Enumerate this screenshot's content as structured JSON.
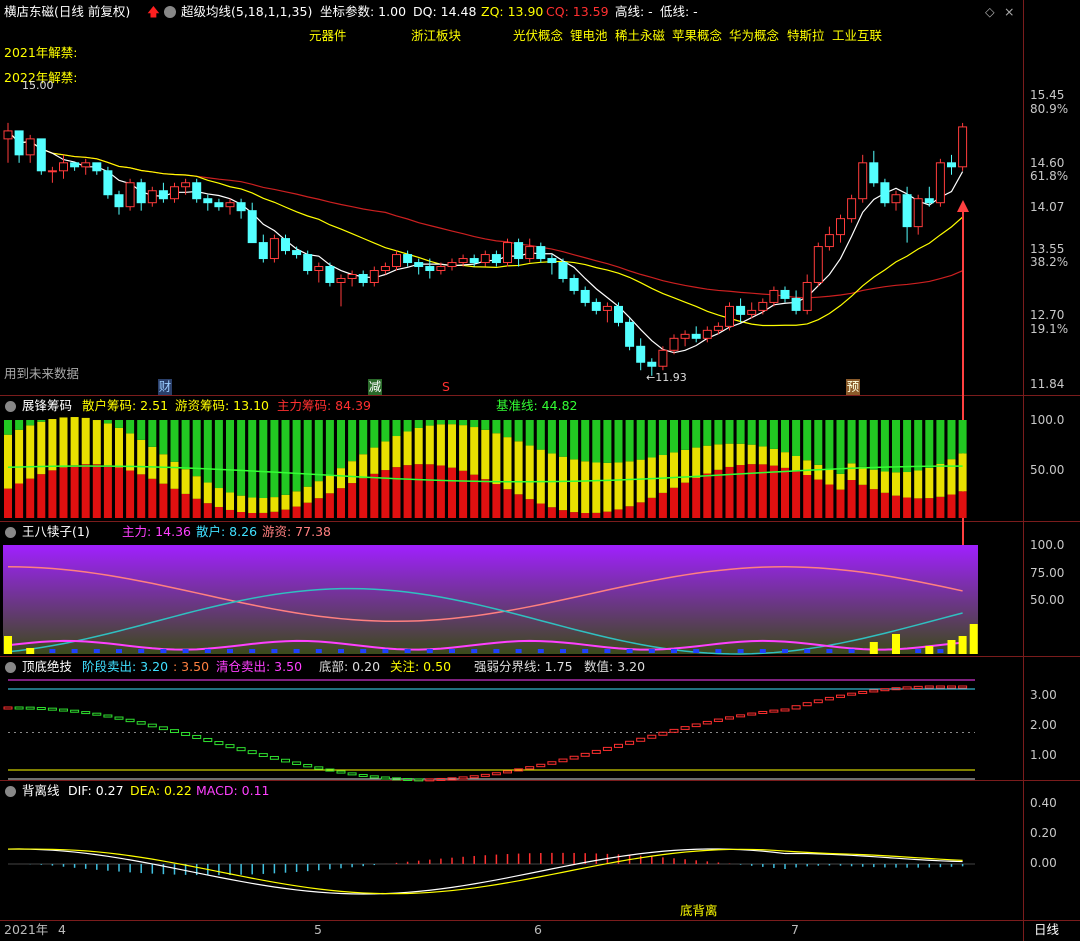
{
  "main": {
    "stock_title": "横店东磁(日线 前复权)",
    "indicator_name": "超级均线(5,18,1,1,35)",
    "params": "坐标参数: 1.00",
    "dq": "DQ: 14.48",
    "zq": "ZQ: 13.90",
    "cq": "CQ: 13.59",
    "high_line": "高线: -",
    "low_line": "低线: -",
    "tags": [
      "元器件",
      "浙江板块",
      "光伏概念",
      "锂电池",
      "稀土永磁",
      "苹果概念",
      "华为概念",
      "特斯拉",
      "工业互联"
    ],
    "unlock_2021": "2021年解禁:",
    "unlock_2022": "2022年解禁:",
    "future_data": "用到未来数据",
    "max_price_label": "15.00",
    "min_price_label": "←11.93",
    "y_ticks": [
      "15.45",
      "80.9%",
      "14.60",
      "61.8%",
      "14.07",
      "13.55",
      "38.2%",
      "12.70",
      "19.1%",
      "11.84"
    ],
    "markers": {
      "cai": "财",
      "jian": "减",
      "s": "S",
      "yu": "预"
    }
  },
  "chips": {
    "title": "展锋筹码",
    "retail": "散户筹码: 2.51",
    "hot": "游资筹码: 13.10",
    "main": "主力筹码: 84.39",
    "baseline": "基准线: 44.82",
    "y_ticks": [
      "100.0",
      "50.00"
    ]
  },
  "wbz": {
    "title": "王八犊子(1)",
    "main": "主力: 14.36",
    "retail": "散户: 8.26",
    "hot": "游资: 77.38",
    "y_ticks": [
      "100.0",
      "75.00",
      "50.00"
    ]
  },
  "topbottom": {
    "title": "顶底绝技",
    "stage_sell": "阶段卖出: 3.20",
    "stage_sell2": ": 3.50",
    "clear_sell": "清仓卖出: 3.50",
    "bottom": "底部: 0.20",
    "watch": "关注: 0.50",
    "strong_weak": "强弱分界线: 1.75",
    "value": "数值: 3.20",
    "y_ticks": [
      "3.00",
      "2.00",
      "1.00"
    ]
  },
  "macd": {
    "title": "背离线",
    "dif": "DIF: 0.27",
    "dea": "DEA: 0.22",
    "macd": "MACD: 0.11",
    "bottom_div": "底背离",
    "y_ticks": [
      "0.40",
      "0.20",
      "0.00"
    ]
  },
  "footer": {
    "dates": [
      "2021年",
      "4",
      "5",
      "6",
      "7"
    ],
    "period": "日线"
  },
  "colors": {
    "up": "#ff3c3c",
    "down": "#54ffff",
    "ma5": "#ffffff",
    "ma18": "#ffff00",
    "ma35": "#cc2020",
    "retail": "#ffd700",
    "hot": "#ff4444",
    "main_chip": "#33cc33",
    "magenta": "#ff40ff",
    "cyan": "#40c0ff"
  },
  "chart_data": {
    "type": "candlestick",
    "title": "横店东磁(日线 前复权)",
    "ylim": [
      11.84,
      15.45
    ],
    "candles": [
      [
        14.9,
        15.1,
        14.6,
        15.0
      ],
      [
        15.0,
        15.0,
        14.6,
        14.7
      ],
      [
        14.7,
        14.95,
        14.6,
        14.9
      ],
      [
        14.9,
        14.9,
        14.45,
        14.5
      ],
      [
        14.5,
        14.55,
        14.35,
        14.5
      ],
      [
        14.5,
        14.7,
        14.4,
        14.6
      ],
      [
        14.6,
        14.6,
        14.5,
        14.55
      ],
      [
        14.55,
        14.65,
        14.45,
        14.6
      ],
      [
        14.6,
        14.6,
        14.45,
        14.5
      ],
      [
        14.5,
        14.55,
        14.15,
        14.2
      ],
      [
        14.2,
        14.25,
        13.95,
        14.05
      ],
      [
        14.05,
        14.4,
        14.0,
        14.35
      ],
      [
        14.35,
        14.4,
        14.0,
        14.1
      ],
      [
        14.1,
        14.3,
        14.05,
        14.25
      ],
      [
        14.25,
        14.35,
        14.1,
        14.15
      ],
      [
        14.15,
        14.35,
        14.1,
        14.3
      ],
      [
        14.3,
        14.4,
        14.2,
        14.35
      ],
      [
        14.35,
        14.4,
        14.1,
        14.15
      ],
      [
        14.15,
        14.2,
        14.0,
        14.1
      ],
      [
        14.1,
        14.15,
        14.0,
        14.05
      ],
      [
        14.05,
        14.15,
        13.95,
        14.1
      ],
      [
        14.1,
        14.15,
        13.9,
        14.0
      ],
      [
        14.0,
        14.1,
        13.6,
        13.6
      ],
      [
        13.6,
        13.7,
        13.35,
        13.4
      ],
      [
        13.4,
        13.7,
        13.35,
        13.65
      ],
      [
        13.65,
        13.7,
        13.45,
        13.5
      ],
      [
        13.5,
        13.55,
        13.4,
        13.45
      ],
      [
        13.45,
        13.5,
        13.2,
        13.25
      ],
      [
        13.25,
        13.35,
        13.1,
        13.3
      ],
      [
        13.3,
        13.35,
        13.05,
        13.1
      ],
      [
        13.1,
        13.2,
        12.8,
        13.15
      ],
      [
        13.15,
        13.25,
        13.05,
        13.2
      ],
      [
        13.2,
        13.25,
        13.05,
        13.1
      ],
      [
        13.1,
        13.3,
        13.05,
        13.25
      ],
      [
        13.25,
        13.35,
        13.2,
        13.3
      ],
      [
        13.3,
        13.5,
        13.25,
        13.45
      ],
      [
        13.45,
        13.5,
        13.3,
        13.35
      ],
      [
        13.35,
        13.4,
        13.2,
        13.3
      ],
      [
        13.3,
        13.4,
        13.15,
        13.25
      ],
      [
        13.25,
        13.35,
        13.2,
        13.3
      ],
      [
        13.3,
        13.4,
        13.25,
        13.35
      ],
      [
        13.35,
        13.45,
        13.3,
        13.4
      ],
      [
        13.4,
        13.45,
        13.3,
        13.35
      ],
      [
        13.35,
        13.5,
        13.3,
        13.45
      ],
      [
        13.45,
        13.5,
        13.3,
        13.35
      ],
      [
        13.35,
        13.65,
        13.3,
        13.6
      ],
      [
        13.6,
        13.65,
        13.3,
        13.4
      ],
      [
        13.4,
        13.65,
        13.35,
        13.55
      ],
      [
        13.55,
        13.6,
        13.35,
        13.4
      ],
      [
        13.4,
        13.45,
        13.2,
        13.35
      ],
      [
        13.35,
        13.4,
        13.1,
        13.15
      ],
      [
        13.15,
        13.2,
        12.95,
        13.0
      ],
      [
        13.0,
        13.05,
        12.8,
        12.85
      ],
      [
        12.85,
        12.9,
        12.7,
        12.75
      ],
      [
        12.75,
        12.85,
        12.6,
        12.8
      ],
      [
        12.8,
        12.85,
        12.55,
        12.6
      ],
      [
        12.6,
        12.65,
        12.25,
        12.3
      ],
      [
        12.3,
        12.4,
        12.0,
        12.1
      ],
      [
        12.1,
        12.15,
        11.93,
        12.05
      ],
      [
        12.05,
        12.3,
        12.0,
        12.25
      ],
      [
        12.25,
        12.45,
        12.2,
        12.4
      ],
      [
        12.4,
        12.5,
        12.3,
        12.45
      ],
      [
        12.45,
        12.55,
        12.35,
        12.4
      ],
      [
        12.4,
        12.55,
        12.35,
        12.5
      ],
      [
        12.5,
        12.6,
        12.45,
        12.55
      ],
      [
        12.55,
        12.85,
        12.5,
        12.8
      ],
      [
        12.8,
        12.9,
        12.6,
        12.7
      ],
      [
        12.7,
        12.85,
        12.65,
        12.75
      ],
      [
        12.75,
        12.9,
        12.7,
        12.85
      ],
      [
        12.85,
        13.05,
        12.8,
        13.0
      ],
      [
        13.0,
        13.05,
        12.85,
        12.9
      ],
      [
        12.9,
        13.0,
        12.7,
        12.75
      ],
      [
        12.75,
        13.2,
        12.7,
        13.1
      ],
      [
        13.1,
        13.6,
        13.05,
        13.55
      ],
      [
        13.55,
        13.8,
        13.5,
        13.7
      ],
      [
        13.7,
        13.95,
        13.6,
        13.9
      ],
      [
        13.9,
        14.2,
        13.85,
        14.15
      ],
      [
        14.15,
        14.7,
        14.1,
        14.6
      ],
      [
        14.6,
        14.75,
        14.3,
        14.35
      ],
      [
        14.35,
        14.4,
        14.05,
        14.1
      ],
      [
        14.1,
        14.25,
        14.0,
        14.2
      ],
      [
        14.2,
        14.3,
        13.6,
        13.8
      ],
      [
        13.8,
        14.2,
        13.7,
        14.15
      ],
      [
        14.15,
        14.3,
        14.05,
        14.1
      ],
      [
        14.1,
        14.65,
        14.05,
        14.6
      ],
      [
        14.6,
        14.7,
        14.45,
        14.55
      ],
      [
        14.55,
        15.1,
        14.5,
        15.05
      ]
    ]
  }
}
